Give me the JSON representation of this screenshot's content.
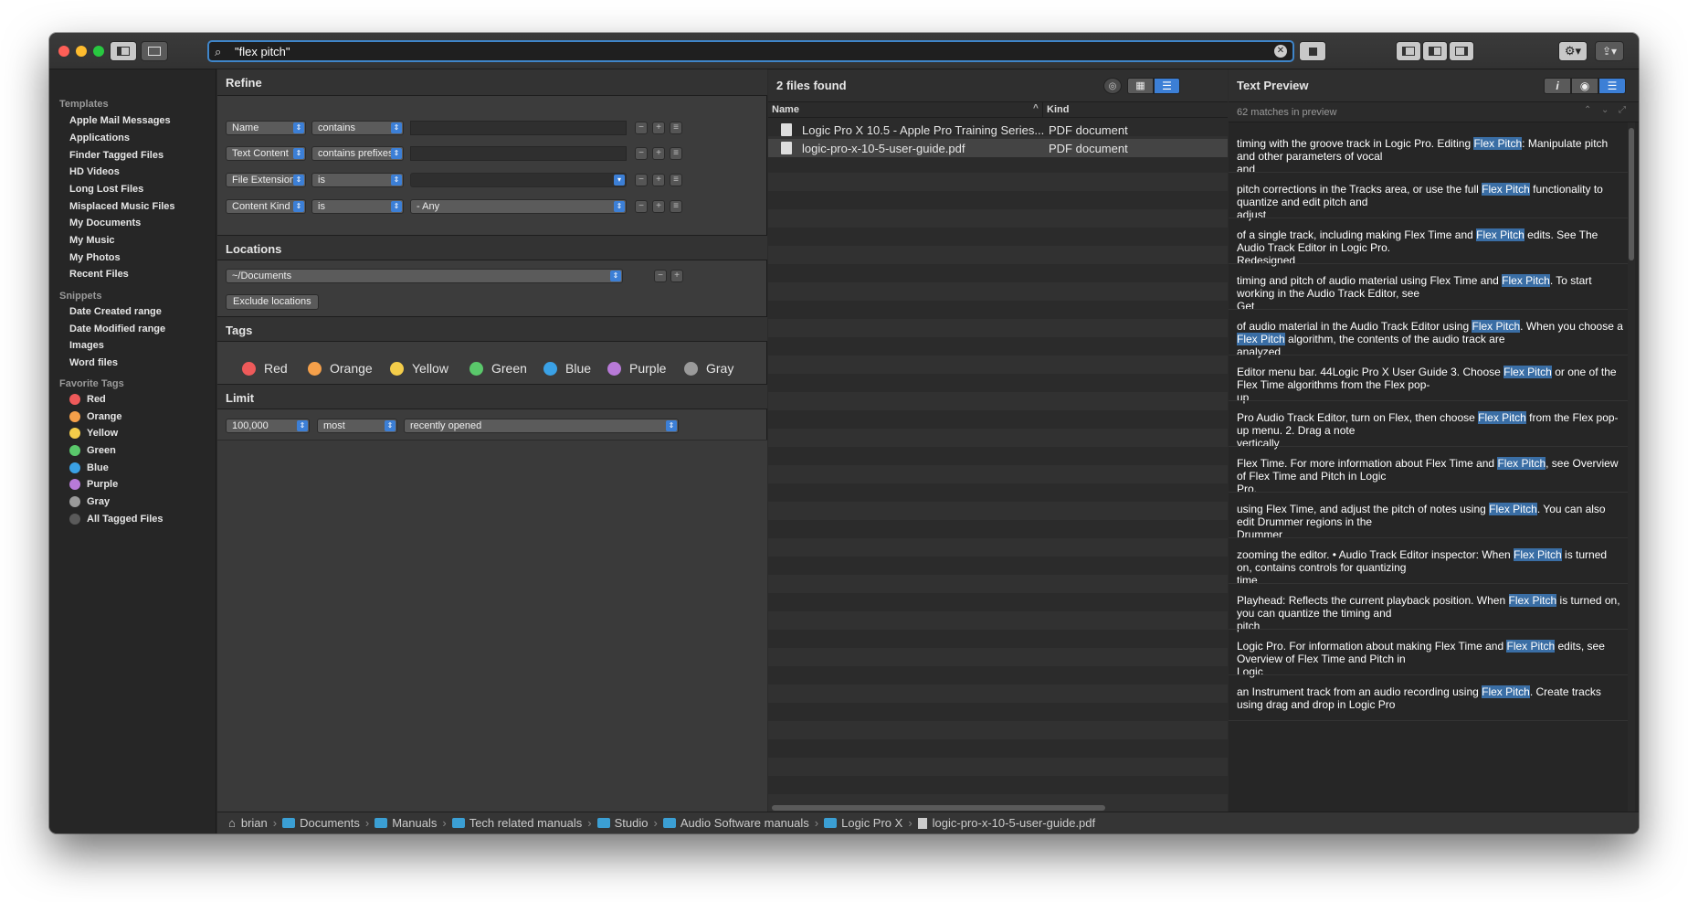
{
  "search": {
    "query": "\"flex pitch\""
  },
  "sidebar": {
    "templates_header": "Templates",
    "templates": [
      "Apple Mail Messages",
      "Applications",
      "Finder Tagged Files",
      "HD Videos",
      "Long Lost Files",
      "Misplaced Music Files",
      "My Documents",
      "My Music",
      "My Photos",
      "Recent Files"
    ],
    "snippets_header": "Snippets",
    "snippets": [
      "Date Created range",
      "Date Modified range",
      "Images",
      "Word files"
    ],
    "tags_header": "Favorite Tags",
    "tags": [
      {
        "label": "Red",
        "color": "#ee5a5a"
      },
      {
        "label": "Orange",
        "color": "#f5a04a"
      },
      {
        "label": "Yellow",
        "color": "#f4cd4a"
      },
      {
        "label": "Green",
        "color": "#5ac86b"
      },
      {
        "label": "Blue",
        "color": "#3aa1e6"
      },
      {
        "label": "Purple",
        "color": "#b87ad8"
      },
      {
        "label": "Gray",
        "color": "#9a9a9a"
      },
      {
        "label": "All Tagged Files",
        "color": "#5a5a5a"
      }
    ]
  },
  "refine": {
    "title": "Refine",
    "rows": [
      {
        "attr": "Name",
        "op": "contains",
        "value": ""
      },
      {
        "attr": "Text Content",
        "op": "contains prefixes",
        "value": ""
      },
      {
        "attr": "File Extension",
        "op": "is",
        "value": ""
      },
      {
        "attr": "Content Kind",
        "op": "is",
        "value": "- Any"
      }
    ],
    "locations_title": "Locations",
    "location": "~/Documents",
    "exclude_label": "Exclude locations",
    "tags_title": "Tags",
    "tags": [
      {
        "label": "Red",
        "color": "#ee5a5a"
      },
      {
        "label": "Orange",
        "color": "#f5a04a"
      },
      {
        "label": "Yellow",
        "color": "#f4cd4a"
      },
      {
        "label": "Green",
        "color": "#5ac86b"
      },
      {
        "label": "Blue",
        "color": "#3aa1e6"
      },
      {
        "label": "Purple",
        "color": "#b87ad8"
      },
      {
        "label": "Gray",
        "color": "#9a9a9a"
      }
    ],
    "limit_title": "Limit",
    "limit_count": "100,000",
    "limit_mode": "most",
    "limit_sort": "recently opened"
  },
  "results": {
    "title": "2 files found",
    "col_name": "Name",
    "col_kind": "Kind",
    "files": [
      {
        "name": "Logic Pro X 10.5 - Apple Pro Training Series...",
        "kind": "PDF document"
      },
      {
        "name": "logic-pro-x-10-5-user-guide.pdf",
        "kind": "PDF document"
      }
    ]
  },
  "preview": {
    "title": "Text Preview",
    "matches": "62 matches in preview",
    "items": [
      [
        [
          "timing with the groove track in Logic Pro. Editing ",
          0
        ],
        [
          "Flex Pitch",
          1
        ],
        [
          ": Manipulate pitch and other parameters of vocal",
          0
        ],
        [
          "\nand",
          0
        ]
      ],
      [
        [
          "pitch corrections in the Tracks area, or use the full ",
          0
        ],
        [
          "Flex Pitch",
          1
        ],
        [
          " functionality to quantize and edit pitch and",
          0
        ],
        [
          "\nadjust",
          0
        ]
      ],
      [
        [
          "of a single track, including making Flex Time and ",
          0
        ],
        [
          "Flex Pitch",
          1
        ],
        [
          " edits. See The Audio Track Editor in Logic Pro.",
          0
        ],
        [
          "\nRedesigned",
          0
        ]
      ],
      [
        [
          "timing and pitch of audio material using Flex Time and ",
          0
        ],
        [
          "Flex Pitch",
          1
        ],
        [
          ". To start working in the Audio Track Editor, see",
          0
        ],
        [
          "\nGet",
          0
        ]
      ],
      [
        [
          "of audio material in the Audio Track Editor using ",
          0
        ],
        [
          "Flex Pitch",
          1
        ],
        [
          ". When you choose a ",
          0
        ],
        [
          "Flex Pitch",
          1
        ],
        [
          " algorithm, the contents of the audio track are",
          0
        ],
        [
          "\nanalyzed",
          0
        ]
      ],
      [
        [
          "Editor menu bar. 44Logic Pro X User Guide 3. Choose ",
          0
        ],
        [
          "Flex Pitch",
          1
        ],
        [
          " or one of the Flex Time algorithms from the Flex pop-",
          0
        ],
        [
          "\nup",
          0
        ]
      ],
      [
        [
          "Pro Audio Track Editor, turn on Flex, then choose ",
          0
        ],
        [
          "Flex Pitch",
          1
        ],
        [
          " from the Flex pop-up menu. 2. Drag a note",
          0
        ],
        [
          "\nvertically",
          0
        ]
      ],
      [
        [
          "Flex Time. For more information about Flex Time and ",
          0
        ],
        [
          "Flex Pitch",
          1
        ],
        [
          ", see Overview of Flex Time and Pitch in Logic",
          0
        ],
        [
          "\nPro.",
          0
        ]
      ],
      [
        [
          "using Flex Time, and adjust the pitch of notes using ",
          0
        ],
        [
          "Flex Pitch",
          1
        ],
        [
          ". You can also edit Drummer regions in the",
          0
        ],
        [
          "\nDrummer",
          0
        ]
      ],
      [
        [
          "zooming the editor. • Audio Track Editor inspector: When ",
          0
        ],
        [
          "Flex Pitch",
          1
        ],
        [
          " is turned on, contains controls for quantizing",
          0
        ],
        [
          "\ntime",
          0
        ]
      ],
      [
        [
          "Playhead: Reflects the current playback position. When ",
          0
        ],
        [
          "Flex Pitch",
          1
        ],
        [
          " is turned on, you can quantize the timing and",
          0
        ],
        [
          "\npitch",
          0
        ]
      ],
      [
        [
          "Logic Pro. For information about making Flex Time and ",
          0
        ],
        [
          "Flex Pitch",
          1
        ],
        [
          " edits, see Overview of Flex Time and Pitch in",
          0
        ],
        [
          "\nLogic",
          0
        ]
      ],
      [
        [
          "an Instrument track from an audio recording using ",
          0
        ],
        [
          "Flex Pitch",
          1
        ],
        [
          ". Create tracks using drag and drop in Logic Pro",
          0
        ]
      ]
    ]
  },
  "path": [
    "brian",
    "Documents",
    "Manuals",
    "Tech related manuals",
    "Studio",
    "Audio Software manuals",
    "Logic Pro X",
    "logic-pro-x-10-5-user-guide.pdf"
  ]
}
